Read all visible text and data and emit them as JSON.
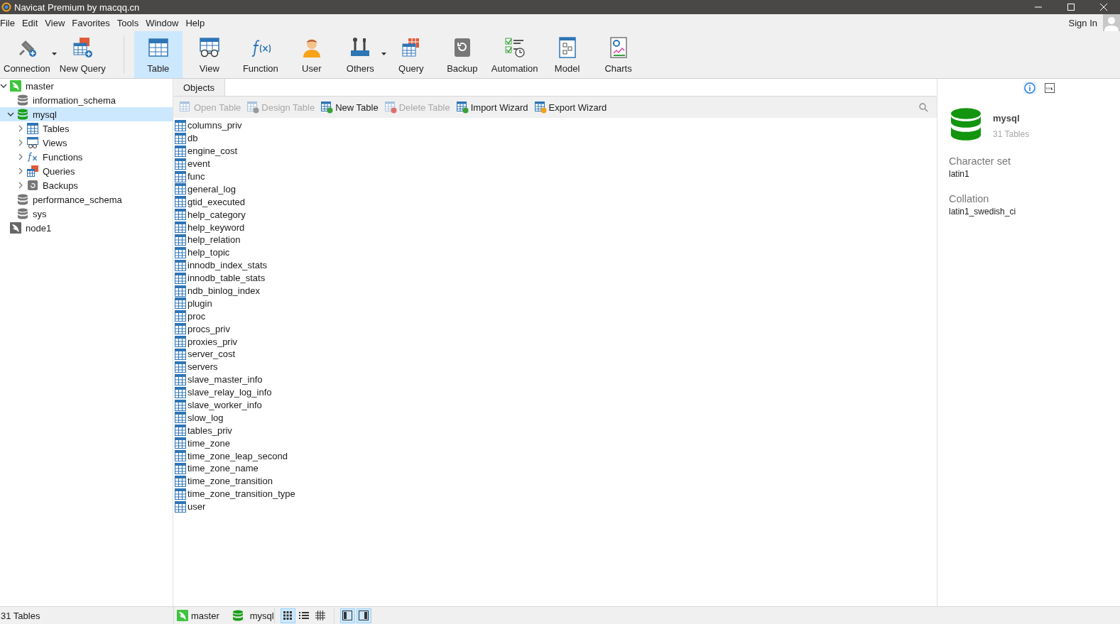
{
  "window": {
    "title": "Navicat Premium by macqq.cn"
  },
  "menu": [
    "File",
    "Edit",
    "View",
    "Favorites",
    "Tools",
    "Window",
    "Help"
  ],
  "sign_in": "Sign In",
  "toolbar": [
    {
      "kind": "connection",
      "label": "Connection",
      "selected": false,
      "dropdown": true
    },
    {
      "kind": "newquery",
      "label": "New Query",
      "selected": false
    },
    {
      "kind": "separator"
    },
    {
      "kind": "table",
      "label": "Table",
      "selected": true
    },
    {
      "kind": "view",
      "label": "View",
      "selected": false
    },
    {
      "kind": "function",
      "label": "Function",
      "selected": false
    },
    {
      "kind": "user",
      "label": "User",
      "selected": false
    },
    {
      "kind": "others",
      "label": "Others",
      "selected": false,
      "dropdown": true
    },
    {
      "kind": "query",
      "label": "Query",
      "selected": false
    },
    {
      "kind": "backup",
      "label": "Backup",
      "selected": false
    },
    {
      "kind": "automation",
      "label": "Automation",
      "selected": false
    },
    {
      "kind": "model",
      "label": "Model",
      "selected": false
    },
    {
      "kind": "charts",
      "label": "Charts",
      "selected": false
    }
  ],
  "sidebar": {
    "tree": [
      {
        "kind": "connection",
        "label": "master",
        "expanded": true,
        "selected": false,
        "children": [
          {
            "kind": "db",
            "label": "information_schema",
            "selected": false
          },
          {
            "kind": "db-open",
            "label": "mysql",
            "expanded": true,
            "selected": true,
            "children": [
              {
                "kind": "tables",
                "label": "Tables",
                "expanded": false,
                "selected": false
              },
              {
                "kind": "views",
                "label": "Views",
                "expanded": false,
                "selected": false
              },
              {
                "kind": "functions",
                "label": "Functions",
                "expanded": false,
                "selected": false
              },
              {
                "kind": "queries",
                "label": "Queries",
                "expanded": false,
                "selected": false
              },
              {
                "kind": "backups",
                "label": "Backups",
                "expanded": false,
                "selected": false
              }
            ]
          },
          {
            "kind": "db",
            "label": "performance_schema",
            "selected": false
          },
          {
            "kind": "db",
            "label": "sys",
            "selected": false
          }
        ]
      },
      {
        "kind": "connection-off",
        "label": "node1",
        "selected": false
      }
    ]
  },
  "objects_tab": {
    "label": "Objects",
    "selected": true
  },
  "object_toolbar": [
    {
      "kind": "open",
      "label": "Open Table",
      "disabled": true
    },
    {
      "kind": "design",
      "label": "Design Table",
      "disabled": true
    },
    {
      "kind": "new",
      "label": "New Table",
      "disabled": false
    },
    {
      "kind": "delete",
      "label": "Delete Table",
      "disabled": true
    },
    {
      "kind": "import",
      "label": "Import Wizard",
      "disabled": false
    },
    {
      "kind": "export",
      "label": "Export Wizard",
      "disabled": false
    }
  ],
  "tables": [
    "columns_priv",
    "db",
    "engine_cost",
    "event",
    "func",
    "general_log",
    "gtid_executed",
    "help_category",
    "help_keyword",
    "help_relation",
    "help_topic",
    "innodb_index_stats",
    "innodb_table_stats",
    "ndb_binlog_index",
    "plugin",
    "proc",
    "procs_priv",
    "proxies_priv",
    "server_cost",
    "servers",
    "slave_master_info",
    "slave_relay_log_info",
    "slave_worker_info",
    "slow_log",
    "tables_priv",
    "time_zone",
    "time_zone_leap_second",
    "time_zone_name",
    "time_zone_transition",
    "time_zone_transition_type",
    "user"
  ],
  "info_panel": {
    "tabs": [
      {
        "kind": "info",
        "selected": true
      },
      {
        "kind": "ddl",
        "selected": false
      }
    ],
    "name": "mysql",
    "count": "31 Tables",
    "fields": [
      {
        "label": "Character set",
        "value": "latin1"
      },
      {
        "label": "Collation",
        "value": "latin1_swedish_ci"
      }
    ]
  },
  "status_bar": {
    "left": "31 Tables",
    "connection": "master",
    "database": "mysql",
    "view_modes": [
      {
        "kind": "icons",
        "selected": true
      },
      {
        "kind": "list",
        "selected": false
      },
      {
        "kind": "detail",
        "selected": false
      }
    ],
    "panels": [
      {
        "kind": "left",
        "selected": true
      },
      {
        "kind": "right",
        "selected": true
      }
    ]
  }
}
